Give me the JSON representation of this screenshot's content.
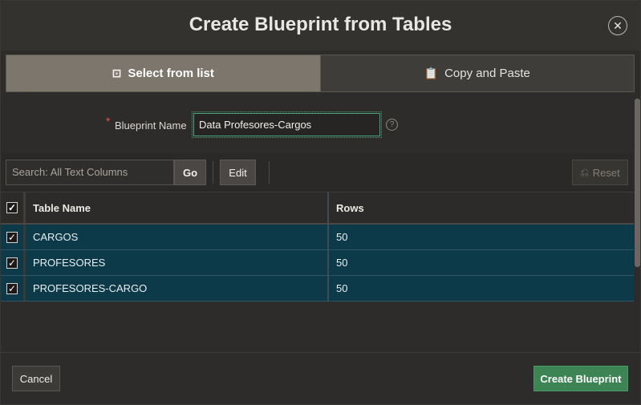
{
  "dialog": {
    "title": "Create Blueprint from Tables",
    "close_icon": "close-icon"
  },
  "tabs": [
    {
      "label": "Select from list",
      "icon": "list-select-icon",
      "active": true
    },
    {
      "label": "Copy and Paste",
      "icon": "clipboard-icon",
      "active": false
    }
  ],
  "form": {
    "blueprint_name_label": "Blueprint Name",
    "required_marker": "*",
    "blueprint_name_value": "Data Profesores-Cargos",
    "help_glyph": "?"
  },
  "toolbar": {
    "search_placeholder": "Search: All Text Columns",
    "go_label": "Go",
    "edit_label": "Edit",
    "reset_label": "Reset"
  },
  "table": {
    "columns": [
      "Table Name",
      "Rows"
    ],
    "header_checked": true,
    "rows": [
      {
        "name": "CARGOS",
        "rows": "50",
        "checked": true
      },
      {
        "name": "PROFESORES",
        "rows": "50",
        "checked": true
      },
      {
        "name": "PROFESORES-CARGO",
        "rows": "50",
        "checked": true
      }
    ]
  },
  "footer": {
    "cancel_label": "Cancel",
    "create_label": "Create Blueprint"
  },
  "colors": {
    "selected_row": "#0d3a49",
    "primary_button": "#3d8455",
    "active_tab": "#7d766d",
    "required": "#e0564c"
  }
}
